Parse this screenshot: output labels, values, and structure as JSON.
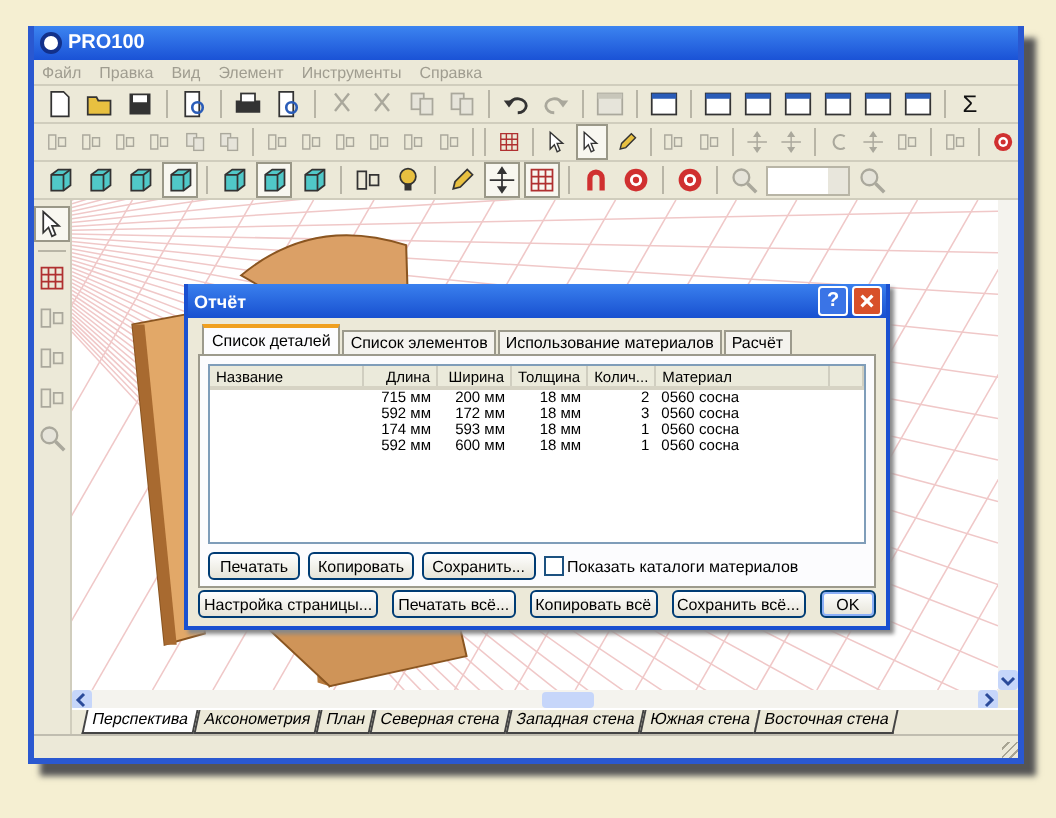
{
  "window": {
    "title": "PRO100"
  },
  "menu": [
    "Файл",
    "Правка",
    "Вид",
    "Элемент",
    "Инструменты",
    "Справка"
  ],
  "toolbars": [
    [
      {
        "kind": "doc",
        "disabled": false,
        "pressed": false
      },
      {
        "kind": "folder",
        "disabled": false,
        "pressed": false
      },
      {
        "kind": "disk",
        "disabled": false,
        "pressed": false
      },
      {
        "kind": "separator"
      },
      {
        "kind": "preview",
        "disabled": false,
        "pressed": false
      },
      {
        "kind": "separator"
      },
      {
        "kind": "printer",
        "disabled": false,
        "pressed": false
      },
      {
        "kind": "preview",
        "disabled": false,
        "pressed": false
      },
      {
        "kind": "separator"
      },
      {
        "kind": "cut",
        "disabled": true,
        "pressed": false
      },
      {
        "kind": "cut",
        "disabled": true,
        "pressed": false
      },
      {
        "kind": "copy",
        "disabled": true,
        "pressed": false
      },
      {
        "kind": "copy",
        "disabled": true,
        "pressed": false
      },
      {
        "kind": "separator"
      },
      {
        "kind": "undo",
        "disabled": false,
        "pressed": false
      },
      {
        "kind": "redo",
        "disabled": true,
        "pressed": false
      },
      {
        "kind": "separator"
      },
      {
        "kind": "panel",
        "disabled": true,
        "pressed": false
      },
      {
        "kind": "separator"
      },
      {
        "kind": "panel",
        "disabled": false,
        "pressed": false
      },
      {
        "kind": "separator"
      },
      {
        "kind": "panel",
        "disabled": false,
        "pressed": false
      },
      {
        "kind": "panel",
        "disabled": false,
        "pressed": false
      },
      {
        "kind": "panel",
        "disabled": false,
        "pressed": false
      },
      {
        "kind": "panel",
        "disabled": false,
        "pressed": false
      },
      {
        "kind": "panel",
        "disabled": false,
        "pressed": false
      },
      {
        "kind": "panel",
        "disabled": false,
        "pressed": false
      },
      {
        "kind": "separator"
      },
      {
        "kind": "text",
        "label": "Σ",
        "disabled": false,
        "pressed": false
      }
    ],
    [
      {
        "kind": "align",
        "disabled": true,
        "pressed": false
      },
      {
        "kind": "align",
        "disabled": true,
        "pressed": false
      },
      {
        "kind": "align",
        "disabled": true,
        "pressed": false
      },
      {
        "kind": "align",
        "disabled": true,
        "pressed": false
      },
      {
        "kind": "copy",
        "disabled": true,
        "pressed": false
      },
      {
        "kind": "copy",
        "disabled": true,
        "pressed": false
      },
      {
        "kind": "separator"
      },
      {
        "kind": "align",
        "disabled": true,
        "pressed": false
      },
      {
        "kind": "align",
        "disabled": true,
        "pressed": false
      },
      {
        "kind": "align",
        "disabled": true,
        "pressed": false
      },
      {
        "kind": "align",
        "disabled": true,
        "pressed": false
      },
      {
        "kind": "align",
        "disabled": true,
        "pressed": false
      },
      {
        "kind": "align",
        "disabled": true,
        "pressed": false
      },
      {
        "kind": "separator"
      },
      {
        "kind": "separator"
      },
      {
        "kind": "grid",
        "disabled": false,
        "pressed": false
      },
      {
        "kind": "separator"
      },
      {
        "kind": "cursor",
        "disabled": false,
        "pressed": false
      },
      {
        "kind": "cursor",
        "disabled": false,
        "pressed": true
      },
      {
        "kind": "pencil",
        "disabled": false,
        "pressed": false
      },
      {
        "kind": "separator"
      },
      {
        "kind": "align",
        "disabled": true,
        "pressed": false
      },
      {
        "kind": "align",
        "disabled": true,
        "pressed": false
      },
      {
        "kind": "separator"
      },
      {
        "kind": "move",
        "disabled": true,
        "pressed": false
      },
      {
        "kind": "move",
        "disabled": true,
        "pressed": false
      },
      {
        "kind": "separator"
      },
      {
        "kind": "rotate",
        "disabled": true,
        "pressed": false
      },
      {
        "kind": "move",
        "disabled": true,
        "pressed": false
      },
      {
        "kind": "align",
        "disabled": true,
        "pressed": false
      },
      {
        "kind": "separator"
      },
      {
        "kind": "align",
        "disabled": true,
        "pressed": false
      },
      {
        "kind": "separator"
      },
      {
        "kind": "target",
        "disabled": false,
        "pressed": false
      }
    ],
    [
      {
        "kind": "cube",
        "disabled": false,
        "pressed": false
      },
      {
        "kind": "cube",
        "disabled": false,
        "pressed": false
      },
      {
        "kind": "cube",
        "disabled": false,
        "pressed": false
      },
      {
        "kind": "cube",
        "disabled": false,
        "pressed": true
      },
      {
        "kind": "separator"
      },
      {
        "kind": "cube",
        "disabled": false,
        "pressed": false
      },
      {
        "kind": "cube",
        "disabled": false,
        "pressed": true
      },
      {
        "kind": "cube",
        "disabled": false,
        "pressed": false
      },
      {
        "kind": "separator"
      },
      {
        "kind": "align",
        "disabled": false,
        "pressed": false
      },
      {
        "kind": "bulb",
        "disabled": false,
        "pressed": false
      },
      {
        "kind": "separator"
      },
      {
        "kind": "pencil",
        "disabled": false,
        "pressed": false
      },
      {
        "kind": "move",
        "disabled": false,
        "pressed": true
      },
      {
        "kind": "grid",
        "disabled": false,
        "pressed": true
      },
      {
        "kind": "separator"
      },
      {
        "kind": "magnet",
        "disabled": false,
        "pressed": false
      },
      {
        "kind": "target",
        "disabled": false,
        "pressed": false
      },
      {
        "kind": "separator"
      },
      {
        "kind": "target",
        "disabled": false,
        "pressed": false
      },
      {
        "kind": "separator"
      },
      {
        "kind": "zoom",
        "disabled": true,
        "pressed": false
      },
      {
        "kind": "combo",
        "disabled": true
      },
      {
        "kind": "zoom",
        "disabled": true,
        "pressed": false
      }
    ]
  ],
  "side_toolbar": [
    {
      "kind": "cursor",
      "disabled": false,
      "pressed": true
    },
    {
      "kind": "separator"
    },
    {
      "kind": "grid",
      "disabled": false,
      "pressed": false
    },
    {
      "kind": "align",
      "disabled": true,
      "pressed": false
    },
    {
      "kind": "align",
      "disabled": true,
      "pressed": false
    },
    {
      "kind": "align",
      "disabled": true,
      "pressed": false
    },
    {
      "kind": "zoom",
      "disabled": true,
      "pressed": false
    }
  ],
  "view_tabs": [
    {
      "label": "Перспектива",
      "selected": true
    },
    {
      "label": "Аксонометрия",
      "selected": false
    },
    {
      "label": "План",
      "selected": false
    },
    {
      "label": "Северная стена",
      "selected": false
    },
    {
      "label": "Западная стена",
      "selected": false
    },
    {
      "label": "Южная стена",
      "selected": false
    },
    {
      "label": "Восточная стена",
      "selected": false
    }
  ],
  "dialog": {
    "title": "Отчёт",
    "help": "?",
    "tabs": [
      {
        "label": "Список деталей",
        "selected": true
      },
      {
        "label": "Список элементов",
        "selected": false
      },
      {
        "label": "Использование материалов",
        "selected": false
      },
      {
        "label": "Расчёт",
        "selected": false
      }
    ],
    "table": {
      "columns": [
        "Название",
        "Длина",
        "Ширина",
        "Толщина",
        "Колич...",
        "Материал"
      ],
      "rows": [
        [
          "",
          "715 мм",
          "200 мм",
          "18 мм",
          "2",
          "0560 сосна"
        ],
        [
          "",
          "592 мм",
          "172 мм",
          "18 мм",
          "3",
          "0560 сосна"
        ],
        [
          "",
          "174 мм",
          "593 мм",
          "18 мм",
          "1",
          "0560 сосна"
        ],
        [
          "",
          "592 мм",
          "600 мм",
          "18 мм",
          "1",
          "0560 сосна"
        ]
      ]
    },
    "buttons": [
      "Печатать",
      "Копировать",
      "Сохранить..."
    ],
    "checkbox": {
      "label": "Показать каталоги материалов",
      "checked": false
    },
    "footer_buttons": [
      {
        "label": "Настройка страницы...",
        "default": false
      },
      {
        "label": "Печатать всё...",
        "default": false
      },
      {
        "label": "Копировать всё",
        "default": false
      },
      {
        "label": "Сохранить всё...",
        "default": false
      },
      {
        "label": "OK",
        "default": true
      }
    ]
  }
}
